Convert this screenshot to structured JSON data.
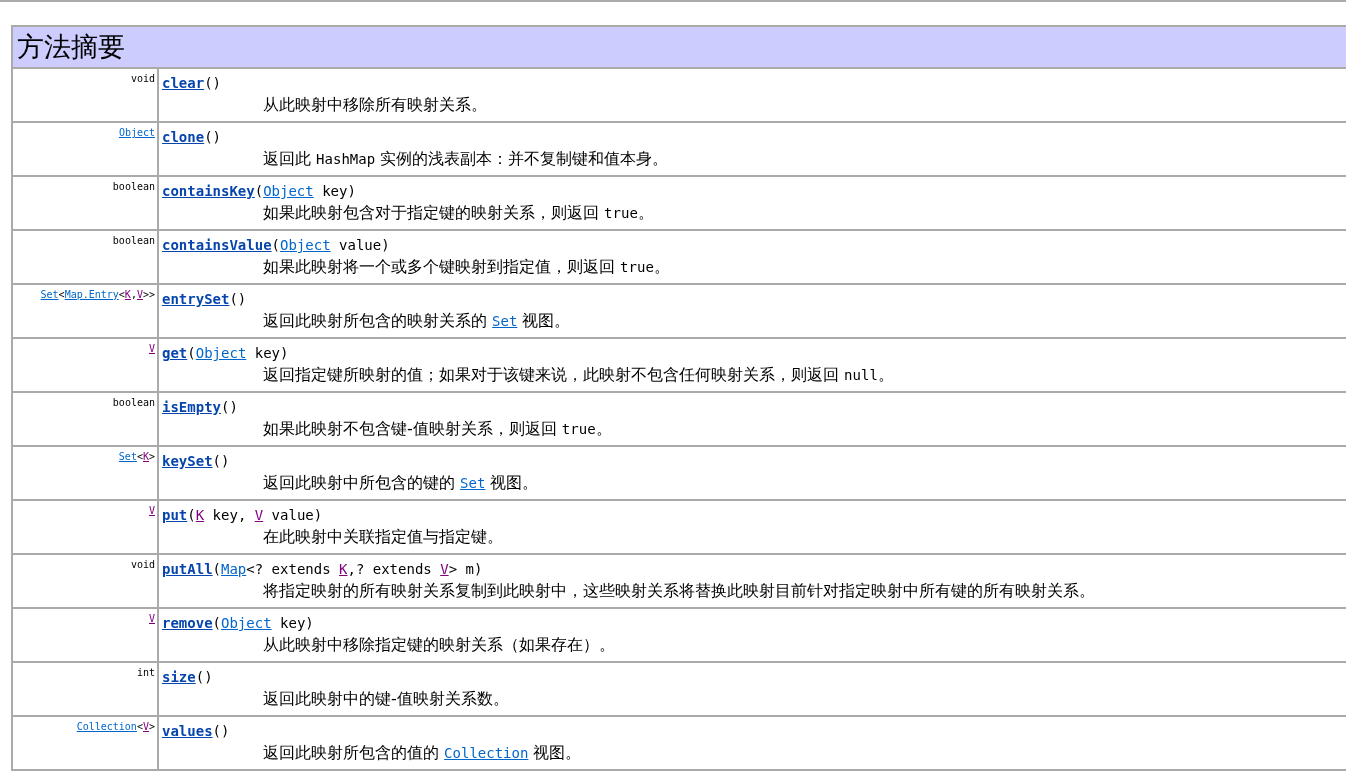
{
  "section_title": "方法摘要",
  "methods": [
    {
      "return_type": [
        {
          "kind": "plain",
          "text": "void"
        }
      ],
      "name": "clear",
      "params": [
        {
          "kind": "plain",
          "text": "()"
        }
      ],
      "description": [
        {
          "kind": "text",
          "text": "从此映射中移除所有映射关系。"
        }
      ]
    },
    {
      "return_type": [
        {
          "kind": "link",
          "text": "Object"
        }
      ],
      "name": "clone",
      "params": [
        {
          "kind": "plain",
          "text": "()"
        }
      ],
      "description": [
        {
          "kind": "text",
          "text": "返回此 "
        },
        {
          "kind": "code",
          "text": "HashMap"
        },
        {
          "kind": "text",
          "text": " 实例的浅表副本：并不复制键和值本身。"
        }
      ]
    },
    {
      "return_type": [
        {
          "kind": "plain",
          "text": "boolean"
        }
      ],
      "name": "containsKey",
      "params": [
        {
          "kind": "plain",
          "text": "("
        },
        {
          "kind": "link",
          "text": "Object"
        },
        {
          "kind": "plain",
          "text": " key)"
        }
      ],
      "description": [
        {
          "kind": "text",
          "text": "如果此映射包含对于指定键的映射关系，则返回 "
        },
        {
          "kind": "code",
          "text": "true"
        },
        {
          "kind": "text",
          "text": "。"
        }
      ]
    },
    {
      "return_type": [
        {
          "kind": "plain",
          "text": "boolean"
        }
      ],
      "name": "containsValue",
      "params": [
        {
          "kind": "plain",
          "text": "("
        },
        {
          "kind": "link",
          "text": "Object"
        },
        {
          "kind": "plain",
          "text": " value)"
        }
      ],
      "description": [
        {
          "kind": "text",
          "text": "如果此映射将一个或多个键映射到指定值，则返回 "
        },
        {
          "kind": "code",
          "text": "true"
        },
        {
          "kind": "text",
          "text": "。"
        }
      ]
    },
    {
      "return_type": [
        {
          "kind": "link",
          "text": "Set"
        },
        {
          "kind": "plain",
          "text": "<"
        },
        {
          "kind": "link",
          "text": "Map.Entry"
        },
        {
          "kind": "plain",
          "text": "<"
        },
        {
          "kind": "type_param",
          "text": "K"
        },
        {
          "kind": "plain",
          "text": ","
        },
        {
          "kind": "type_param",
          "text": "V"
        },
        {
          "kind": "plain",
          "text": ">>"
        }
      ],
      "name": "entrySet",
      "params": [
        {
          "kind": "plain",
          "text": "()"
        }
      ],
      "description": [
        {
          "kind": "text",
          "text": "返回此映射所包含的映射关系的 "
        },
        {
          "kind": "code_link",
          "text": "Set"
        },
        {
          "kind": "text",
          "text": " 视图。"
        }
      ]
    },
    {
      "return_type": [
        {
          "kind": "type_param",
          "text": "V"
        }
      ],
      "name": "get",
      "params": [
        {
          "kind": "plain",
          "text": "("
        },
        {
          "kind": "link",
          "text": "Object"
        },
        {
          "kind": "plain",
          "text": " key)"
        }
      ],
      "description": [
        {
          "kind": "text",
          "text": "返回指定键所映射的值；如果对于该键来说，此映射不包含任何映射关系，则返回 "
        },
        {
          "kind": "code",
          "text": "null"
        },
        {
          "kind": "text",
          "text": "。"
        }
      ]
    },
    {
      "return_type": [
        {
          "kind": "plain",
          "text": "boolean"
        }
      ],
      "name": "isEmpty",
      "params": [
        {
          "kind": "plain",
          "text": "()"
        }
      ],
      "description": [
        {
          "kind": "text",
          "text": "如果此映射不包含键-值映射关系，则返回 "
        },
        {
          "kind": "code",
          "text": "true"
        },
        {
          "kind": "text",
          "text": "。"
        }
      ]
    },
    {
      "return_type": [
        {
          "kind": "link",
          "text": "Set"
        },
        {
          "kind": "plain",
          "text": "<"
        },
        {
          "kind": "type_param",
          "text": "K"
        },
        {
          "kind": "plain",
          "text": ">"
        }
      ],
      "name": "keySet",
      "params": [
        {
          "kind": "plain",
          "text": "()"
        }
      ],
      "description": [
        {
          "kind": "text",
          "text": "返回此映射中所包含的键的 "
        },
        {
          "kind": "code_link",
          "text": "Set"
        },
        {
          "kind": "text",
          "text": " 视图。"
        }
      ]
    },
    {
      "return_type": [
        {
          "kind": "type_param",
          "text": "V"
        }
      ],
      "name": "put",
      "params": [
        {
          "kind": "plain",
          "text": "("
        },
        {
          "kind": "type_param",
          "text": "K"
        },
        {
          "kind": "plain",
          "text": " key, "
        },
        {
          "kind": "type_param",
          "text": "V"
        },
        {
          "kind": "plain",
          "text": " value)"
        }
      ],
      "description": [
        {
          "kind": "text",
          "text": "在此映射中关联指定值与指定键。"
        }
      ]
    },
    {
      "return_type": [
        {
          "kind": "plain",
          "text": "void"
        }
      ],
      "name": "putAll",
      "params": [
        {
          "kind": "plain",
          "text": "("
        },
        {
          "kind": "link",
          "text": "Map"
        },
        {
          "kind": "plain",
          "text": "<? extends "
        },
        {
          "kind": "type_param",
          "text": "K"
        },
        {
          "kind": "plain",
          "text": ",? extends "
        },
        {
          "kind": "type_param",
          "text": "V"
        },
        {
          "kind": "plain",
          "text": "> m)"
        }
      ],
      "description": [
        {
          "kind": "text",
          "text": "将指定映射的所有映射关系复制到此映射中，这些映射关系将替换此映射目前针对指定映射中所有键的所有映射关系。"
        }
      ]
    },
    {
      "return_type": [
        {
          "kind": "type_param",
          "text": "V"
        }
      ],
      "name": "remove",
      "params": [
        {
          "kind": "plain",
          "text": "("
        },
        {
          "kind": "link",
          "text": "Object"
        },
        {
          "kind": "plain",
          "text": " key)"
        }
      ],
      "description": [
        {
          "kind": "text",
          "text": "从此映射中移除指定键的映射关系（如果存在）。"
        }
      ]
    },
    {
      "return_type": [
        {
          "kind": "plain",
          "text": "int"
        }
      ],
      "name": "size",
      "params": [
        {
          "kind": "plain",
          "text": "()"
        }
      ],
      "description": [
        {
          "kind": "text",
          "text": "返回此映射中的键-值映射关系数。"
        }
      ]
    },
    {
      "return_type": [
        {
          "kind": "link",
          "text": "Collection"
        },
        {
          "kind": "plain",
          "text": "<"
        },
        {
          "kind": "type_param",
          "text": "V"
        },
        {
          "kind": "plain",
          "text": ">"
        }
      ],
      "name": "values",
      "params": [
        {
          "kind": "plain",
          "text": "()"
        }
      ],
      "description": [
        {
          "kind": "text",
          "text": "返回此映射所包含的值的 "
        },
        {
          "kind": "code_link",
          "text": "Collection"
        },
        {
          "kind": "text",
          "text": " 视图。"
        }
      ]
    }
  ]
}
